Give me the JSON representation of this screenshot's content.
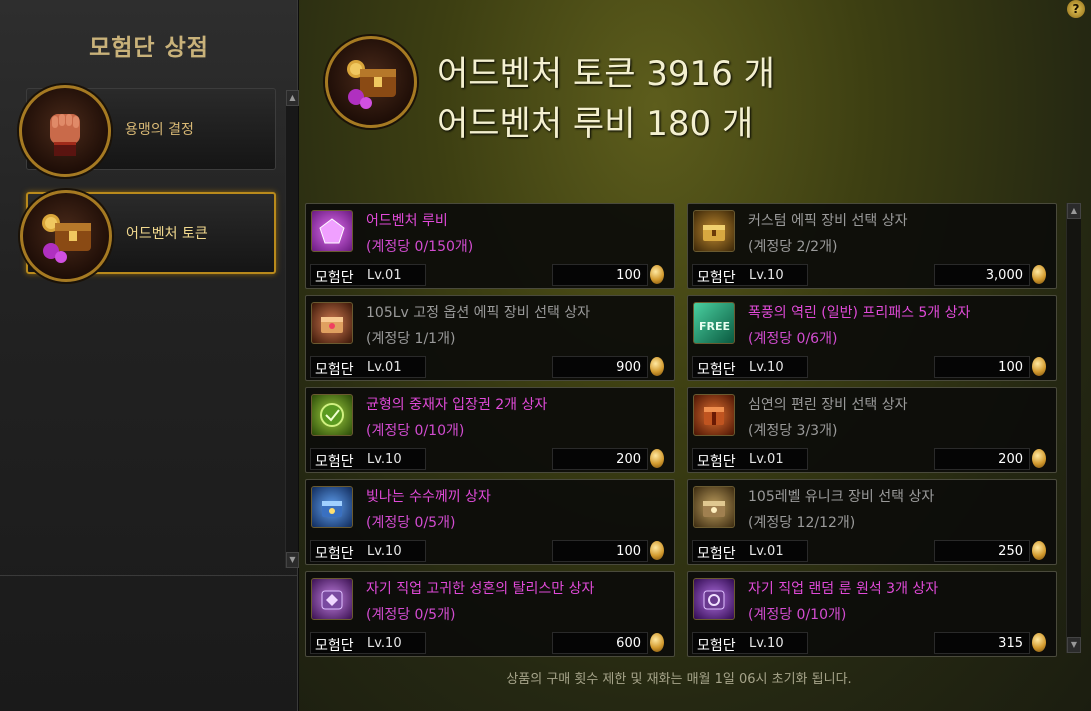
{
  "sidebar": {
    "title": "모험단 상점",
    "items": [
      {
        "label": "용맹의 결정",
        "icon": "fist-icon",
        "active": false
      },
      {
        "label": "어드벤처 토큰",
        "icon": "treasure-chest-icon",
        "active": true
      }
    ]
  },
  "header": {
    "token_balance": "어드벤처 토큰 3916 개",
    "ruby_balance": "어드벤처 루비 180 개",
    "help_label": "?"
  },
  "shop": {
    "level_label": "모험단",
    "items": [
      {
        "name": "어드벤처 루비",
        "limit": "(계정당 0/150개)",
        "level": "Lv.01",
        "price": "100",
        "name_color": "purple",
        "icon": "ruby-gem-icon"
      },
      {
        "name": "커스텀 에픽 장비 선택 상자",
        "limit": "(계정당 2/2개)",
        "level": "Lv.10",
        "price": "3,000",
        "name_color": "gray",
        "icon": "gold-chest-icon"
      },
      {
        "name": "105Lv 고정 옵션 에픽 장비 선택 상자",
        "limit": "(계정당 1/1개)",
        "level": "Lv.01",
        "price": "900",
        "name_color": "gray",
        "icon": "epic-chest-icon"
      },
      {
        "name": "폭풍의 역린 (일반) 프리패스 5개 상자",
        "limit": "(계정당 0/6개)",
        "level": "Lv.10",
        "price": "100",
        "name_color": "purple",
        "icon": "free-pass-icon"
      },
      {
        "name": "균형의 중재자 입장권 2개 상자",
        "limit": "(계정당 0/10개)",
        "level": "Lv.10",
        "price": "200",
        "name_color": "purple",
        "icon": "green-ticket-icon"
      },
      {
        "name": "심연의 편린 장비 선택 상자",
        "limit": "(계정당 3/3개)",
        "level": "Lv.01",
        "price": "200",
        "name_color": "gray",
        "icon": "abyss-box-icon"
      },
      {
        "name": "빛나는 수수께끼 상자",
        "limit": "(계정당 0/5개)",
        "level": "Lv.10",
        "price": "100",
        "name_color": "purple",
        "icon": "mystery-box-icon"
      },
      {
        "name": "105레벨 유니크 장비 선택 상자",
        "limit": "(계정당 12/12개)",
        "level": "Lv.01",
        "price": "250",
        "name_color": "gray",
        "icon": "unique-chest-icon"
      },
      {
        "name": "자기 직업 고귀한 성혼의 탈리스만 상자",
        "limit": "(계정당 0/5개)",
        "level": "Lv.10",
        "price": "600",
        "name_color": "purple",
        "icon": "talisman-box-icon"
      },
      {
        "name": "자기 직업 랜덤 룬 원석 3개 상자",
        "limit": "(계정당 0/10개)",
        "level": "Lv.10",
        "price": "315",
        "name_color": "purple",
        "icon": "rune-box-icon"
      }
    ]
  },
  "footer": {
    "note": "상품의 구매 횟수 제한 및 재화는 매월 1일 06시 초기화 됩니다."
  },
  "colors": {
    "accent_gold": "#b98a1c",
    "item_purple": "#e04ad8",
    "item_gray": "#9a9a9a"
  }
}
